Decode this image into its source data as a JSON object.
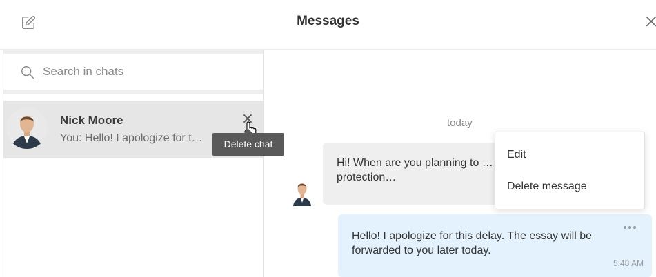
{
  "header": {
    "title": "Messages",
    "compose_icon": "edit-compose-icon",
    "close_icon": "close-icon"
  },
  "search": {
    "placeholder": "Search in chats",
    "icon": "search-icon"
  },
  "chats": [
    {
      "name": "Nick Moore",
      "preview": "You: Hello! I apologize for t…",
      "delete_tooltip": "Delete chat"
    }
  ],
  "conversation": {
    "date_label": "today",
    "messages": [
      {
        "direction": "incoming",
        "text": "Hi! When are you planning to … on environmental protection…"
      },
      {
        "direction": "outgoing",
        "text": "Hello! I apologize for this delay. The essay will be forwarded to you later today.",
        "time": "5:48 AM"
      }
    ]
  },
  "context_menu": {
    "items": [
      {
        "label": "Edit"
      },
      {
        "label": "Delete message"
      }
    ]
  },
  "colors": {
    "accent_bubble_out": "#e3f2fd",
    "bubble_in": "#efefef",
    "selected_chat": "#e6e6e6",
    "tooltip": "#5a5a5a"
  }
}
